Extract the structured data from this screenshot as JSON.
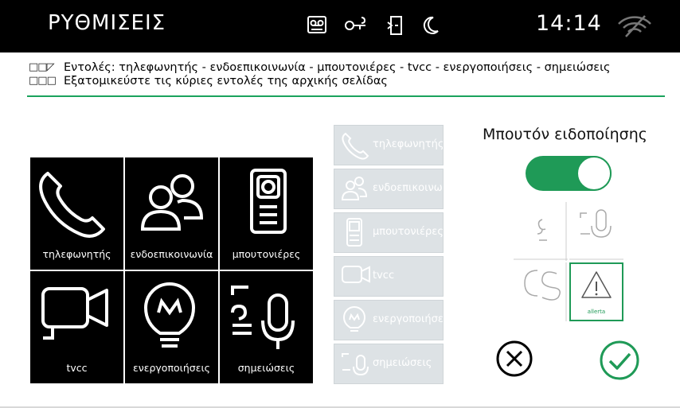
{
  "header": {
    "title": "ΡΥΘΜΙΣΕΙΣ",
    "time": "14:14",
    "status_icons": [
      "voicemail-icon",
      "key-icon",
      "door-icon",
      "moon-icon",
      "wifi-off-icon"
    ]
  },
  "breadcrumb": {
    "line1": "Εντολές: τηλεφωνητής - ενδοεπικοινωνία - μπουτονιέρες - tvcc - ενεργοποιήσεις - σημειώσεις",
    "line2": "Εξατομικεύστε τις κύριες εντολές της αρχικής σελίδας",
    "marks1": "□□◸",
    "marks2": "□□□"
  },
  "tiles": [
    {
      "label": "τηλεφωνητής",
      "icon": "phone-icon"
    },
    {
      "label": "ενδοεπικοινωνία",
      "icon": "intercom-users-icon"
    },
    {
      "label": "μπουτονιέρες",
      "icon": "doorpanel-icon"
    },
    {
      "label": "tvcc",
      "icon": "camera-icon"
    },
    {
      "label": "ενεργοποιήσεις",
      "icon": "bulb-icon"
    },
    {
      "label": "σημειώσεις",
      "icon": "notes-mic-icon"
    }
  ],
  "ghost_list": [
    {
      "label": "τηλεφωνητής"
    },
    {
      "label": "ενδοεπικοινωνία"
    },
    {
      "label": "μπουτονιέρες"
    },
    {
      "label": "tvcc"
    },
    {
      "label": "ενεργοποιήσεις"
    },
    {
      "label": "σημειώσεις"
    }
  ],
  "notification": {
    "label": "Μπουτόν ειδοποίησης",
    "toggle_on": true,
    "selected_label": "allerta",
    "accent": "#1f9a57"
  }
}
